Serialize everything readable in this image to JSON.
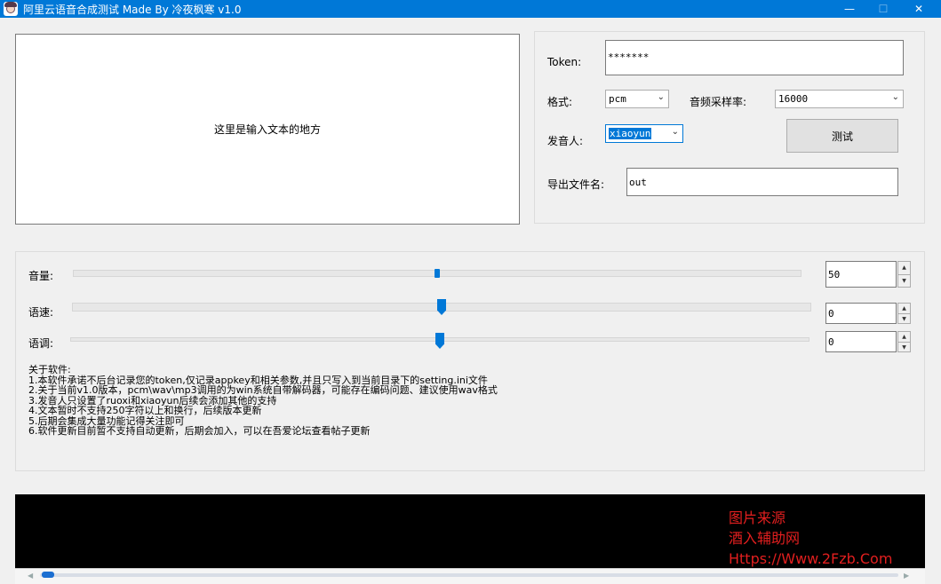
{
  "window": {
    "title": "阿里云语音合成测试 Made By 冷夜枫寒 v1.0",
    "minimize": "—",
    "maximize": "☐",
    "close": "✕"
  },
  "text_input": {
    "placeholder": "这里是输入文本的地方"
  },
  "settings": {
    "token_label": "Token:",
    "token_value": "*******",
    "format_label": "格式:",
    "format_value": "pcm",
    "sample_rate_label": "音频采样率:",
    "sample_rate_value": "16000",
    "voice_label": "发音人:",
    "voice_value": "xiaoyun",
    "test_button": "测试",
    "output_label": "导出文件名:",
    "output_value": "out"
  },
  "sliders": {
    "volume_label": "音量:",
    "volume_value": "50",
    "volume_level": 0.5,
    "speed_label": "语速:",
    "speed_value": "0",
    "speed_level": 0.5,
    "pitch_label": "语调:",
    "pitch_value": "0",
    "pitch_level": 0.5
  },
  "about": {
    "title": "关于软件:",
    "lines": [
      "1.本软件承诺不后台记录您的token,仅记录appkey和相关参数,并且只写入到当前目录下的setting.ini文件",
      "2.关于当前v1.0版本，pcm\\wav\\mp3调用的为win系统自带解码器，可能存在编码问题、建议使用wav格式",
      "3.发音人只设置了ruoxi和xiaoyun后续会添加其他的支持",
      "4.文本暂时不支持250字符以上和换行，后续版本更新",
      "5.后期会集成大量功能记得关注即可",
      "6.软件更新目前暂不支持自动更新，后期会加入，可以在吾爱论坛查看帖子更新"
    ]
  },
  "watermark": {
    "line1": "图片来源",
    "line2": "酒入辅助网",
    "line3": "Https://Www.2Fzb.Com"
  },
  "colors": {
    "titlebar": "#0078d7",
    "accent": "#0078d7",
    "watermark": "#e21f1f"
  },
  "icons": [
    "app-avatar-icon",
    "chevron-down-icon",
    "spin-up-icon",
    "spin-down-icon",
    "seek-left-icon",
    "seek-right-icon"
  ]
}
